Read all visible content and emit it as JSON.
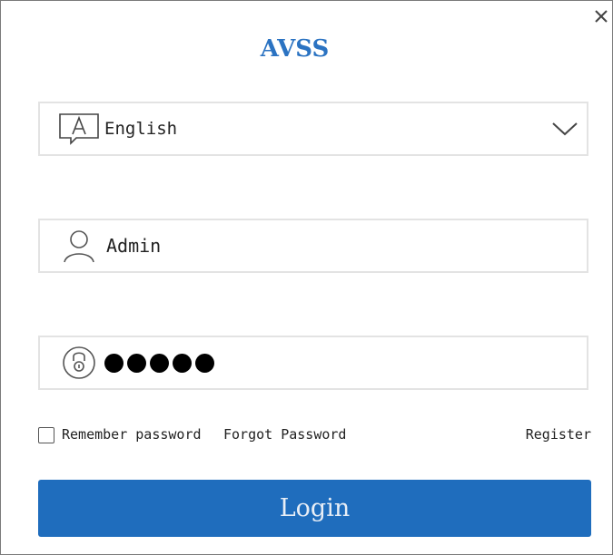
{
  "dialog": {
    "title": "AVSS",
    "close_icon": "close-icon"
  },
  "language": {
    "icon": "language-icon",
    "value": "English",
    "dropdown_icon": "chevron-down-icon"
  },
  "username": {
    "icon": "user-icon",
    "value": "Admin"
  },
  "password": {
    "icon": "lock-icon",
    "masked_length": 5
  },
  "options": {
    "remember_label": "Remember password",
    "remember_checked": false,
    "forgot_label": "Forgot Password",
    "register_label": "Register"
  },
  "login": {
    "label": "Login"
  },
  "colors": {
    "accent": "#2b73c2",
    "button": "#1f6dbd",
    "field_border": "#e3e3e3"
  }
}
